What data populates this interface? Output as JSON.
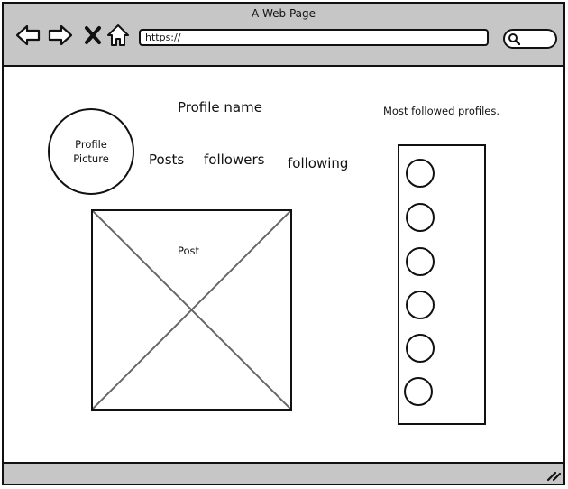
{
  "window": {
    "title": "A Web Page",
    "url": "https://"
  },
  "icons": {
    "back": "back-arrow-icon",
    "forward": "forward-arrow-icon",
    "stop": "close-x-icon",
    "home": "home-icon",
    "search": "search-icon",
    "resize": "resize-grip-icon"
  },
  "profile": {
    "picture_label_line1": "Profile",
    "picture_label_line2": "Picture",
    "name": "Profile name",
    "stats": {
      "posts": "Posts",
      "followers": "followers",
      "following": "following"
    }
  },
  "post": {
    "label": "Post"
  },
  "sidebar": {
    "title": "Most followed profiles.",
    "profiles": [
      {
        "id": 1
      },
      {
        "id": 2
      },
      {
        "id": 3
      },
      {
        "id": 4
      },
      {
        "id": 5
      },
      {
        "id": 6
      }
    ]
  },
  "colors": {
    "chrome": "#c6c6c6",
    "stroke": "#111111",
    "placeholder_x": "#666666"
  }
}
